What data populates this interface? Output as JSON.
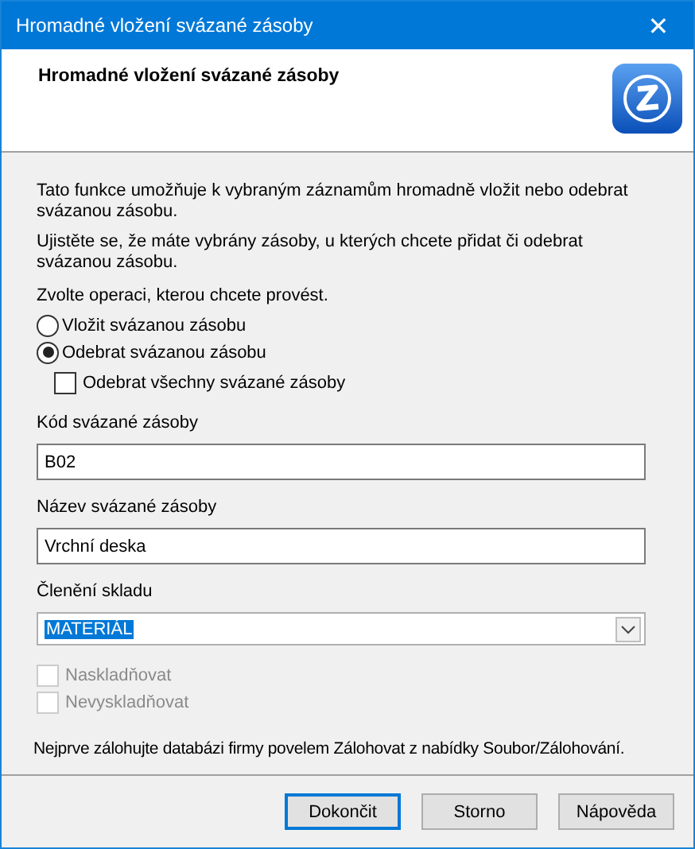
{
  "window": {
    "title": "Hromadné vložení svázané zásoby",
    "close": "✕"
  },
  "header": {
    "title": "Hromadné vložení svázané zásoby"
  },
  "paragraphs": [
    "Tato funkce umožňuje k vybraným záznamům hromadně vložit nebo odebrat svázanou zásobu.",
    "Ujistěte se, že máte vybrány zásoby, u kterých chcete přidat či odebrat svázanou zásobu."
  ],
  "prompt": "Zvolte operaci, kterou chcete provést.",
  "operations": [
    {
      "label": "Vložit svázanou zásobu",
      "selected": false
    },
    {
      "label": "Odebrat svázanou zásobu",
      "selected": true
    }
  ],
  "remove_all": {
    "label": "Odebrat všechny svázané zásoby",
    "checked": false
  },
  "fields": [
    {
      "label": "Kód svázané zásoby",
      "value": "B02"
    },
    {
      "label": "Název svázané zásoby",
      "value": "Vrchní deska"
    }
  ],
  "warehouse": {
    "label": "Členění skladu",
    "value": "MATERIÁL"
  },
  "options": [
    {
      "label": "Naskladňovat",
      "checked": false,
      "disabled": true
    },
    {
      "label": "Nevyskladňovat",
      "checked": false,
      "disabled": true
    }
  ],
  "note": "Nejprve zálohujte databázi firmy povelem Zálohovat z nabídky Soubor/Zálohování.",
  "buttons": [
    {
      "label": "Dokončit",
      "default": true
    },
    {
      "label": "Storno",
      "default": false
    },
    {
      "label": "Nápověda",
      "default": false
    }
  ]
}
